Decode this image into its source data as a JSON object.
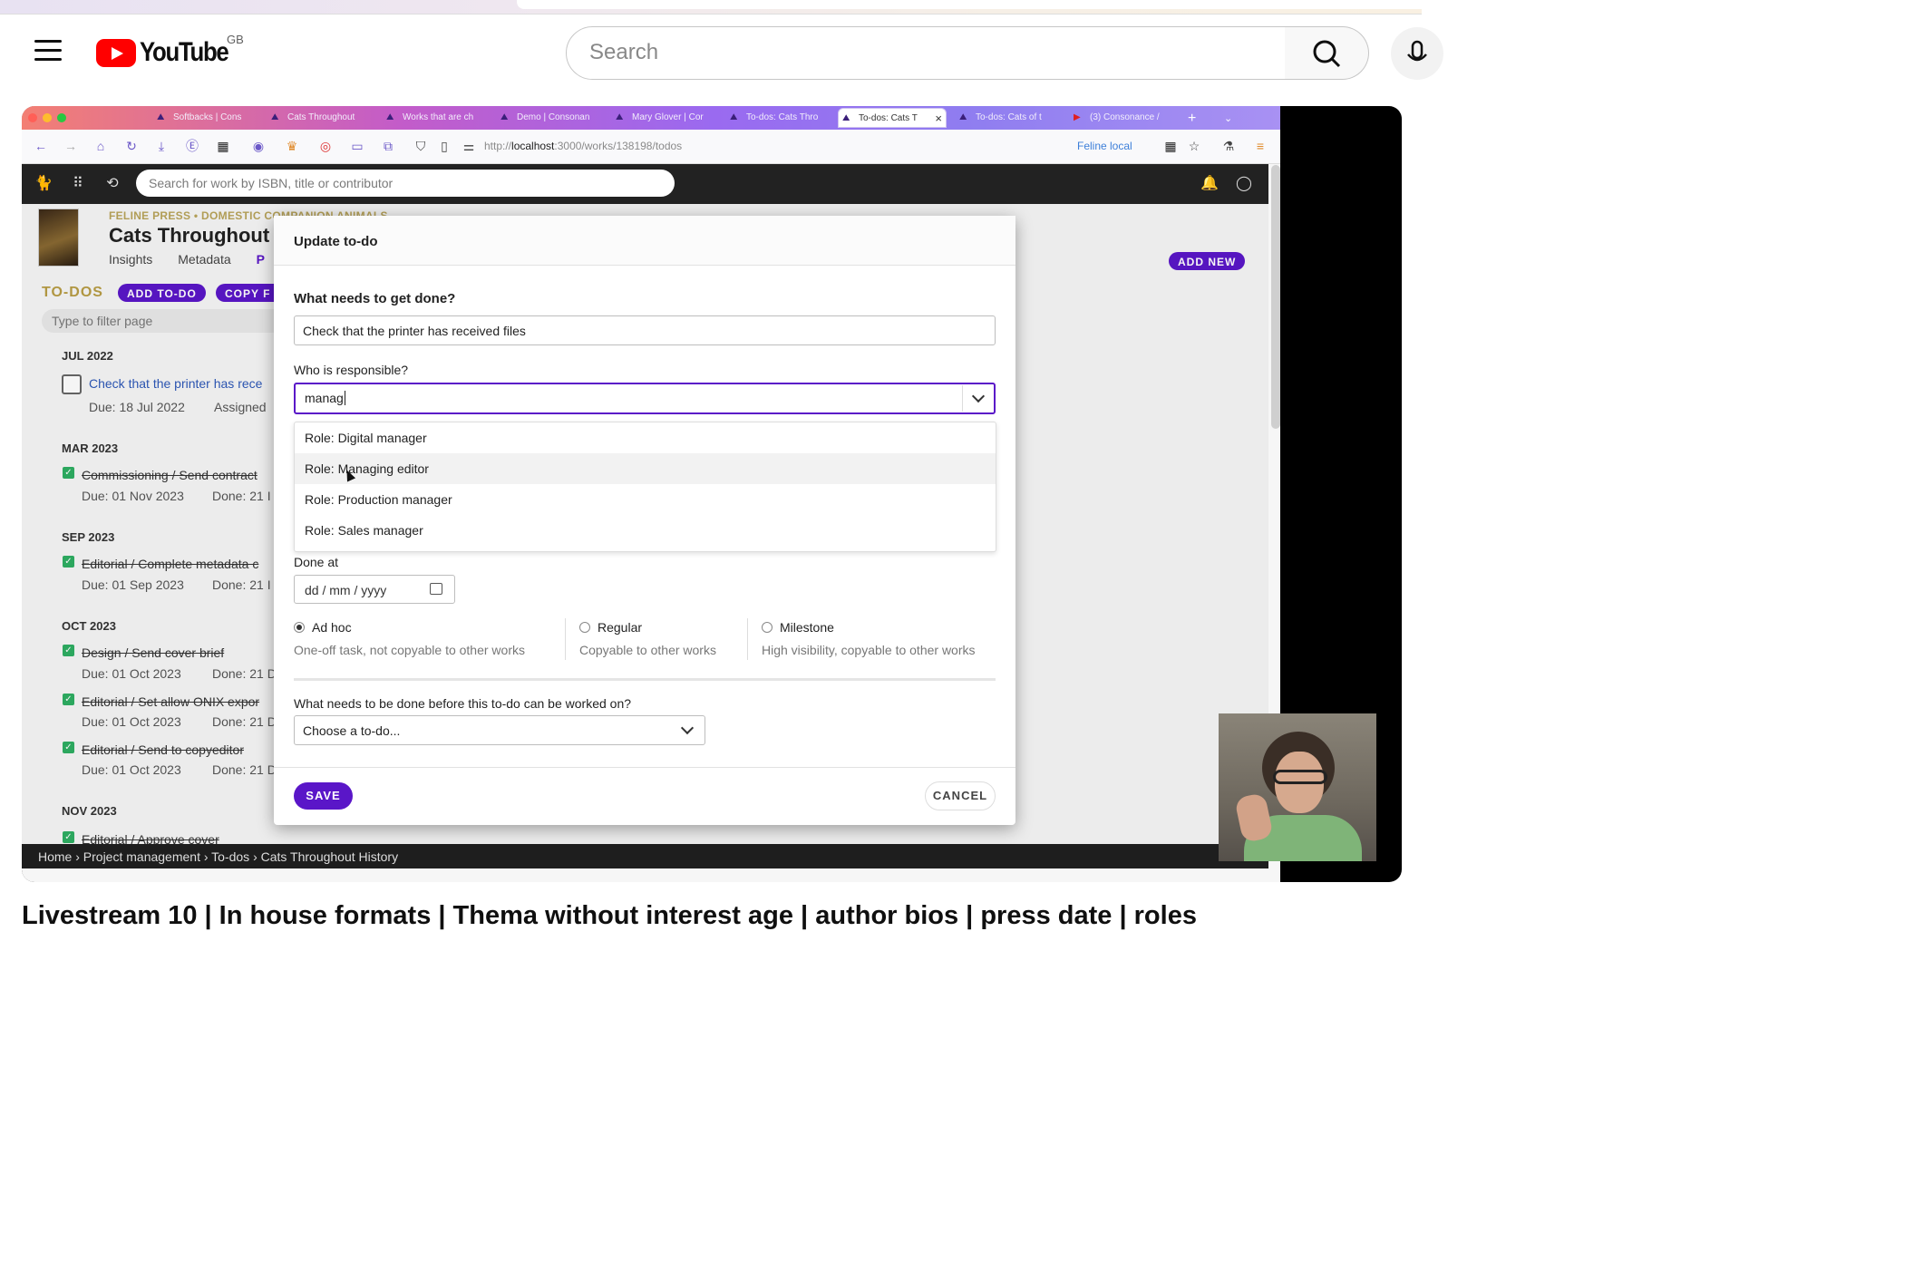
{
  "youtube": {
    "logo_text": "YouTube",
    "region": "GB",
    "search_placeholder": "Search",
    "video_title": "Livestream 10 | In house formats | Thema without interest age | author bios | press date | roles"
  },
  "browser": {
    "tabs": [
      {
        "label": "Softbacks | Cons",
        "active": false
      },
      {
        "label": "Cats Throughout",
        "active": false
      },
      {
        "label": "Works that are ch",
        "active": false
      },
      {
        "label": "Demo | Consonan",
        "active": false
      },
      {
        "label": "Mary Glover | Cor",
        "active": false
      },
      {
        "label": "To-dos: Cats Thro",
        "active": false
      },
      {
        "label": "To-dos: Cats T",
        "active": true
      },
      {
        "label": "To-dos: Cats of t",
        "active": false
      },
      {
        "label": "(3) Consonance /",
        "active": false
      }
    ],
    "url_prefix": "http://",
    "url_host": "localhost",
    "url_path": ":3000/works/138198/todos",
    "env_label": "Feline local"
  },
  "app": {
    "search_placeholder": "Search for work by ISBN, title or contributor",
    "publisher_line": "FELINE PRESS • DOMESTIC COMPANION ANIMALS",
    "work_title": "Cats Throughout",
    "tabs": [
      "Insights",
      "Metadata",
      "P"
    ],
    "add_new": "ADD NEW",
    "todos_heading": "TO-DOS",
    "add_todo": "ADD TO-DO",
    "copy_label": "COPY F",
    "filter_placeholder": "Type to filter page",
    "groups": [
      {
        "month": "JUL 2022",
        "items": [
          {
            "title": "Check that the printer has rece",
            "due": "Due: 18 Jul 2022",
            "extra": "Assigned",
            "done": false
          }
        ]
      },
      {
        "month": "MAR 2023",
        "items": [
          {
            "title": "Commissioning / Send contract",
            "due": "Due: 01 Nov 2023",
            "extra": "Done: 21 I",
            "done": true
          }
        ]
      },
      {
        "month": "SEP 2023",
        "items": [
          {
            "title": "Editorial / Complete metadata c",
            "due": "Due: 01 Sep 2023",
            "extra": "Done: 21 I",
            "done": true
          }
        ]
      },
      {
        "month": "OCT 2023",
        "items": [
          {
            "title": "Design / Send cover brief",
            "due": "Due: 01 Oct 2023",
            "extra": "Done: 21 D",
            "done": true
          },
          {
            "title": "Editorial / Set allow ONIX expor",
            "due": "Due: 01 Oct 2023",
            "extra": "Done: 21 D",
            "done": true
          },
          {
            "title": "Editorial / Send to copyeditor",
            "due": "Due: 01 Oct 2023",
            "extra": "Done: 21 D",
            "done": true
          }
        ]
      },
      {
        "month": "NOV 2023",
        "items": [
          {
            "title": "Editorial / Approve cover",
            "due": "",
            "extra": "",
            "done": true
          }
        ]
      }
    ],
    "breadcrumb": "Home › Project management › To-dos › Cats Throughout History"
  },
  "modal": {
    "title": "Update to-do",
    "what_label": "What needs to get done?",
    "what_value": "Check that the printer has received files",
    "who_label": "Who is responsible?",
    "who_value": "manag",
    "options": [
      "Role: Digital manager",
      "Role: Managing editor",
      "Role: Production manager",
      "Role: Sales manager"
    ],
    "highlighted_option": "Role: Managing editor",
    "done_at_label": "Done at",
    "date_placeholder": "dd / mm / yyyy",
    "types": [
      {
        "label": "Ad hoc",
        "desc": "One-off task, not copyable to other works",
        "selected": true
      },
      {
        "label": "Regular",
        "desc": "Copyable to other works",
        "selected": false
      },
      {
        "label": "Milestone",
        "desc": "High visibility, copyable to other works",
        "selected": false
      }
    ],
    "dependency_label": "What needs to be done before this to-do can be worked on?",
    "dependency_value": "Choose a to-do...",
    "save": "SAVE",
    "cancel": "CANCEL"
  },
  "colors": {
    "accent": "#5a16c8",
    "youtube_red": "#ff0000",
    "gold": "#b89d44",
    "done_green": "#2eae62"
  }
}
